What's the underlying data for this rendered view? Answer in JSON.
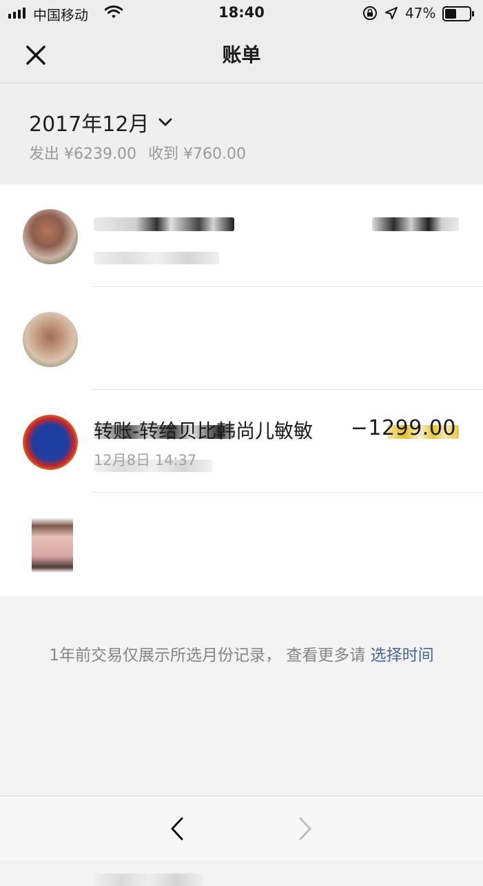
{
  "status_bar": {
    "carrier": "中国移动",
    "time": "18:40",
    "battery_percent": "47%",
    "battery_level": 0.47,
    "icons": [
      "signal-icon",
      "wifi-icon",
      "orientation-lock-icon",
      "location-icon",
      "battery-icon"
    ]
  },
  "nav": {
    "title": "账单",
    "close_icon": "close-icon"
  },
  "month_summary": {
    "month": "2017年12月",
    "expense": "发出 ¥6239.00",
    "income": "收到 ¥760.00",
    "dropdown_icon": "chevron-down-icon"
  },
  "transactions": [
    {
      "title": "",
      "time": "",
      "amount": "",
      "redacted": true
    },
    {
      "title": "",
      "time": "",
      "amount": "",
      "redacted": true,
      "amount_color": "#e6be2e"
    },
    {
      "title": "转账-转给贝比韩尚儿敏敏",
      "time": "12月8日 14:37",
      "amount": "−1299.00",
      "redacted": false
    },
    {
      "title": "",
      "time": "",
      "amount": "",
      "redacted": true
    }
  ],
  "footer": {
    "note": "1年前交易仅展示所选月份记录， 查看更多请",
    "link": "选择时间"
  },
  "toolbar": {
    "back_icon": "back-icon",
    "forward_icon": "forward-icon"
  },
  "colors": {
    "link": "#4a6694",
    "background": "#f3f3f3",
    "list_background": "#ffffff"
  }
}
